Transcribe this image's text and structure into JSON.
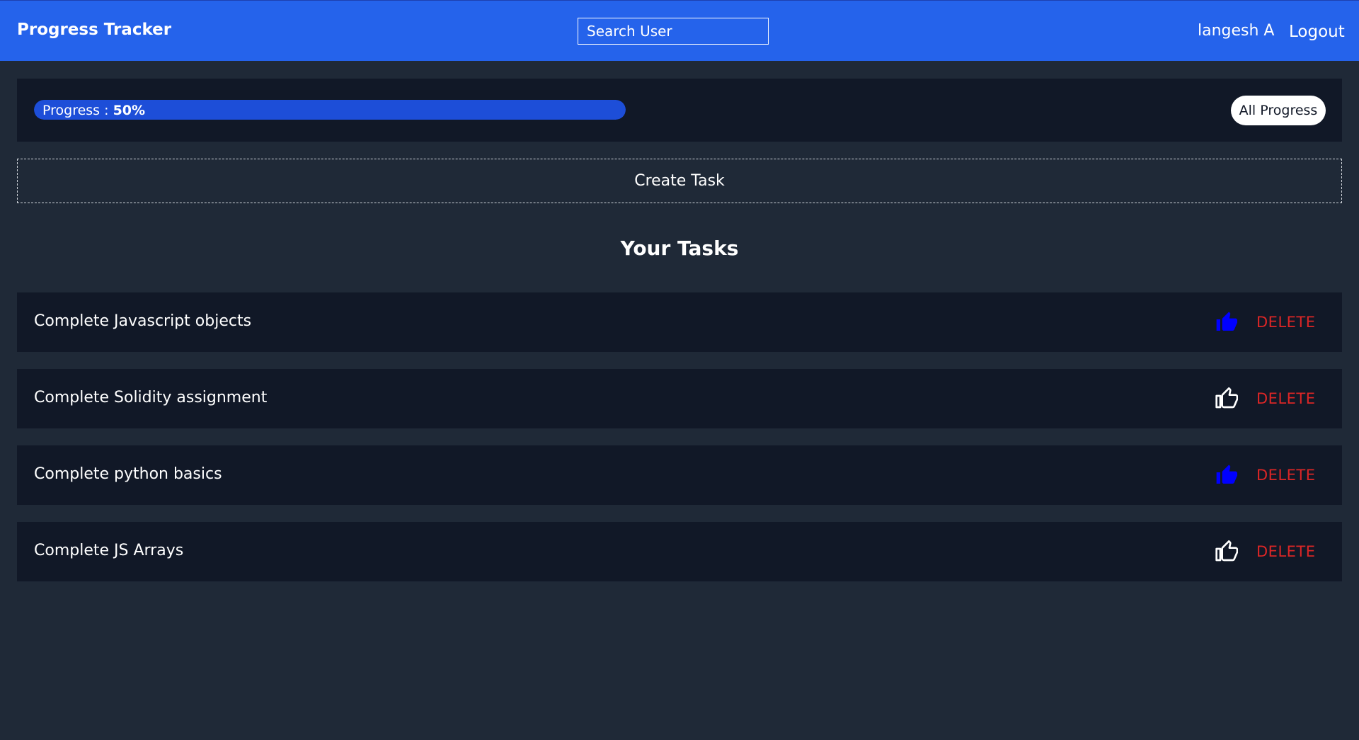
{
  "header": {
    "brand": "Progress Tracker",
    "search_placeholder": "Search User",
    "username": "langesh A",
    "logout_label": "Logout"
  },
  "progress": {
    "label": "Progress : ",
    "value_text": "50%",
    "value": 50,
    "all_progress_label": "All Progress"
  },
  "create_task_label": "Create Task",
  "tasks_title": "Your Tasks",
  "tasks": [
    {
      "name": "Complete Javascript objects",
      "liked": true,
      "delete_label": "DELETE"
    },
    {
      "name": "Complete Solidity assignment",
      "liked": false,
      "delete_label": "DELETE"
    },
    {
      "name": "Complete python basics",
      "liked": true,
      "delete_label": "DELETE"
    },
    {
      "name": "Complete JS Arrays",
      "liked": false,
      "delete_label": "DELETE"
    }
  ],
  "colors": {
    "navbar": "#2563eb",
    "background": "#1f2937",
    "panel": "#111827",
    "progress_fill": "#1d4ed8",
    "liked_icon": "#0000ff",
    "delete": "#dc2626"
  },
  "icons": {
    "like": "thumbs-up-icon"
  }
}
